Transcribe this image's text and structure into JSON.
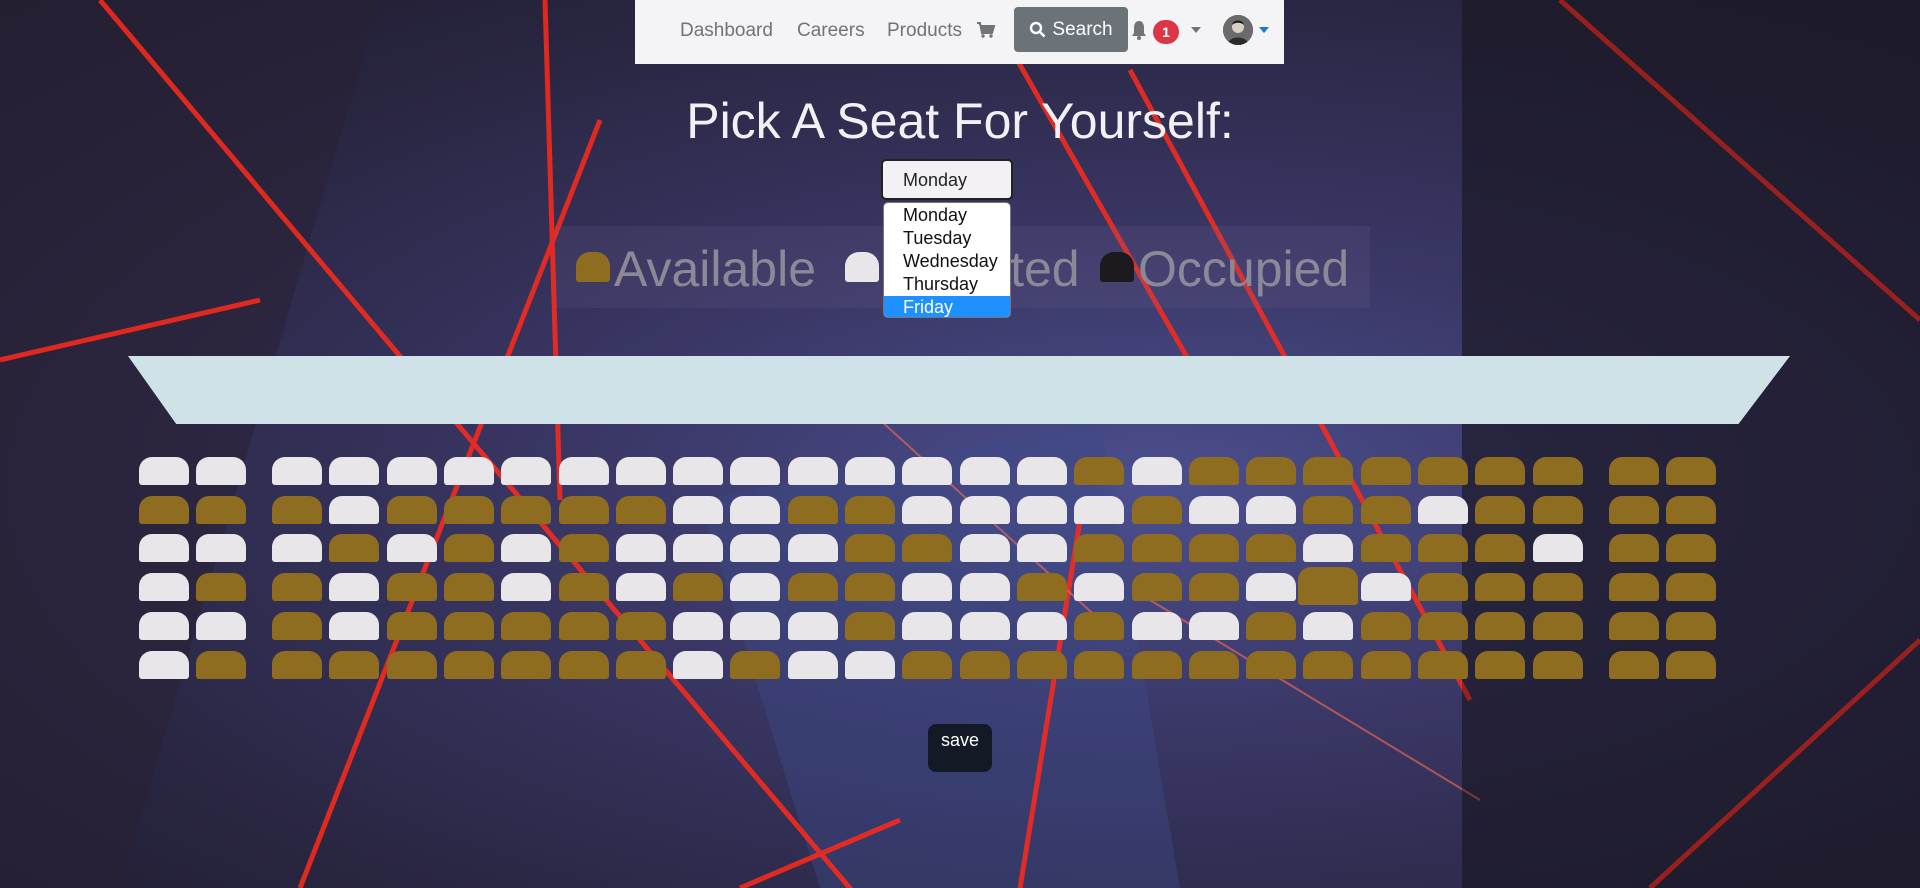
{
  "nav": {
    "links": [
      "Dashboard",
      "Careers",
      "Products"
    ],
    "search_label": "Search",
    "notification_count": "1"
  },
  "page": {
    "title": "Pick A Seat For Yourself:"
  },
  "day_select": {
    "value": "Monday",
    "options": [
      "Monday",
      "Tuesday",
      "Wednesday",
      "Thursday",
      "Friday"
    ],
    "highlighted": "Friday"
  },
  "legend": {
    "available": "Available",
    "selected": "Selected",
    "occupied": "Occupied"
  },
  "colors": {
    "available": "#8f6d20",
    "selected": "#e9e6ea",
    "occupied": "#1c1a1e",
    "highlight": "#1e90ff"
  },
  "seats": [
    [
      "selected",
      "selected",
      "selected",
      "selected",
      "selected",
      "selected",
      "selected",
      "selected",
      "selected",
      "selected",
      "selected",
      "selected",
      "selected",
      "selected",
      "selected",
      "selected",
      "available",
      "selected",
      "available",
      "available",
      "available",
      "available",
      "available",
      "available",
      "available",
      "available",
      "available"
    ],
    [
      "available",
      "available",
      "available",
      "selected",
      "available",
      "available",
      "available",
      "available",
      "available",
      "selected",
      "selected",
      "available",
      "available",
      "selected",
      "selected",
      "selected",
      "selected",
      "available",
      "selected",
      "selected",
      "available",
      "available",
      "selected",
      "available",
      "available",
      "available",
      "available"
    ],
    [
      "selected",
      "selected",
      "selected",
      "available",
      "selected",
      "available",
      "selected",
      "available",
      "selected",
      "selected",
      "selected",
      "selected",
      "available",
      "available",
      "selected",
      "selected",
      "available",
      "available",
      "available",
      "available",
      "selected",
      "available",
      "available",
      "available",
      "selected",
      "available",
      "available"
    ],
    [
      "selected",
      "available",
      "available",
      "selected",
      "available",
      "available",
      "selected",
      "available",
      "selected",
      "available",
      "selected",
      "available",
      "available",
      "selected",
      "selected",
      "available",
      "selected",
      "available",
      "available",
      "selected",
      "available",
      "selected",
      "available",
      "available",
      "available",
      "available",
      "available"
    ],
    [
      "selected",
      "selected",
      "available",
      "selected",
      "available",
      "available",
      "available",
      "available",
      "available",
      "selected",
      "selected",
      "selected",
      "available",
      "selected",
      "selected",
      "selected",
      "available",
      "selected",
      "selected",
      "available",
      "selected",
      "available",
      "available",
      "available",
      "available",
      "available",
      "available"
    ],
    [
      "selected",
      "available",
      "available",
      "available",
      "available",
      "available",
      "available",
      "available",
      "available",
      "selected",
      "available",
      "selected",
      "selected",
      "available",
      "available",
      "available",
      "available",
      "available",
      "available",
      "available",
      "available",
      "available",
      "available",
      "available",
      "available",
      "available",
      "available"
    ]
  ],
  "save_label": "save"
}
